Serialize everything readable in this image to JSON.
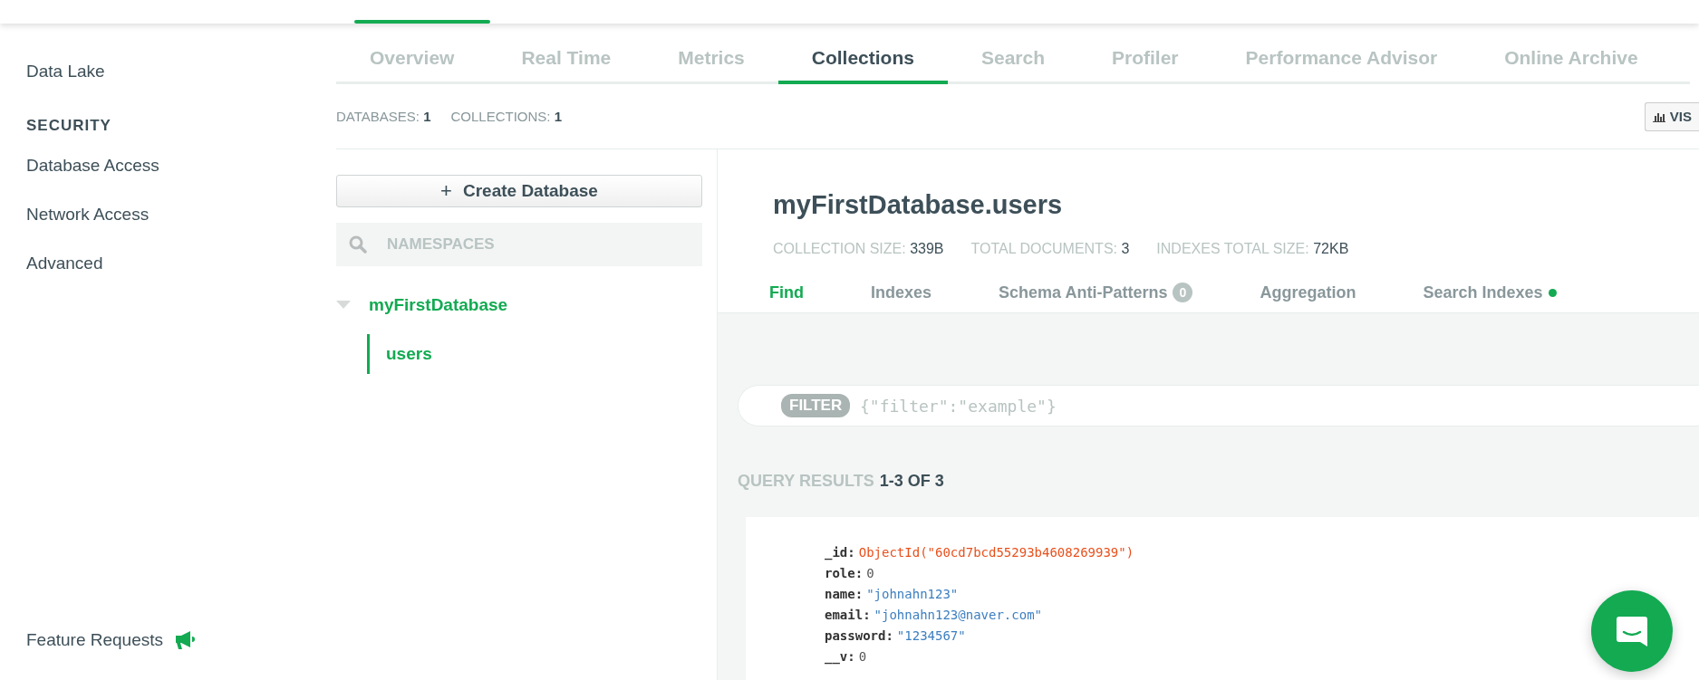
{
  "sidebar": {
    "items": [
      {
        "label": "Data Lake",
        "kind": "item"
      },
      {
        "label": "SECURITY",
        "kind": "heading"
      },
      {
        "label": "Database Access",
        "kind": "item"
      },
      {
        "label": "Network Access",
        "kind": "item"
      },
      {
        "label": "Advanced",
        "kind": "item"
      }
    ],
    "footer": "Feature Requests"
  },
  "tabs": [
    {
      "label": "Overview",
      "selected": false
    },
    {
      "label": "Real Time",
      "selected": false
    },
    {
      "label": "Metrics",
      "selected": false
    },
    {
      "label": "Collections",
      "selected": true
    },
    {
      "label": "Search",
      "selected": false
    },
    {
      "label": "Profiler",
      "selected": false
    },
    {
      "label": "Performance Advisor",
      "selected": false
    },
    {
      "label": "Online Archive",
      "selected": false
    }
  ],
  "summary": [
    {
      "label": "DATABASES:",
      "value": "1"
    },
    {
      "label": "COLLECTIONS:",
      "value": "1"
    }
  ],
  "visualize_button": "VIS",
  "create_button": {
    "icon": "+",
    "label": "Create Database"
  },
  "namespace_search": {
    "placeholder": "NAMESPACES"
  },
  "tree": [
    {
      "label": "myFirstDatabase",
      "expanded": true,
      "children": [
        {
          "label": "users",
          "selected": true
        }
      ]
    }
  ],
  "collection": {
    "title": "myFirstDatabase.users",
    "stats": [
      {
        "label": "COLLECTION SIZE:",
        "value": "339B"
      },
      {
        "label": "TOTAL DOCUMENTS:",
        "value": "3"
      },
      {
        "label": "INDEXES TOTAL SIZE:",
        "value": "72KB"
      }
    ],
    "tabs": [
      {
        "label": "Find",
        "selected": true
      },
      {
        "label": "Indexes",
        "selected": false
      },
      {
        "label": "Schema Anti-Patterns",
        "selected": false,
        "badge": "0"
      },
      {
        "label": "Aggregation",
        "selected": false
      },
      {
        "label": "Search Indexes",
        "selected": false,
        "dot": true
      }
    ]
  },
  "filter": {
    "tag": "FILTER",
    "placeholder": "{\"filter\":\"example\"}"
  },
  "results": {
    "label": "QUERY RESULTS",
    "range": "1-3 OF 3"
  },
  "documents": [
    {
      "fields": [
        {
          "key": "_id:",
          "value": "ObjectId(\"60cd7bcd55293b4608269939\")",
          "kind": "objectid"
        },
        {
          "key": "role:",
          "value": "0",
          "kind": "number"
        },
        {
          "key": "name:",
          "value": "\"johnahn123\"",
          "kind": "string"
        },
        {
          "key": "email:",
          "value": "\"johnahn123@naver.com\"",
          "kind": "string"
        },
        {
          "key": "password:",
          "value": "\"1234567\"",
          "kind": "string"
        },
        {
          "key": "__v:",
          "value": "0",
          "kind": "number"
        }
      ]
    }
  ]
}
